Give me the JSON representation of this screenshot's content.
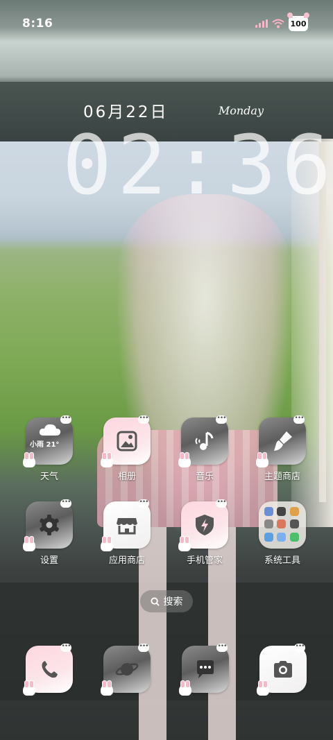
{
  "status_bar": {
    "time": "8:16",
    "battery_level": "100",
    "signal_icon": "signal-icon",
    "wifi_icon": "wifi-icon"
  },
  "clock_widget": {
    "date": "06月22日",
    "weekday": "Monday",
    "time": "02:36"
  },
  "weather_widget": {
    "text": "小雨 21°"
  },
  "apps": [
    {
      "name": "weather",
      "label": "天气",
      "icon": "cloud-icon",
      "tile_color": "#6e6e6e"
    },
    {
      "name": "gallery",
      "label": "相册",
      "icon": "photo-icon",
      "tile_color": "#ffd6df"
    },
    {
      "name": "music",
      "label": "音乐",
      "icon": "music-note-icon",
      "tile_color": "#6e6e6e"
    },
    {
      "name": "themes",
      "label": "主题商店",
      "icon": "paintbrush-icon",
      "tile_color": "#6e6e6e"
    },
    {
      "name": "settings",
      "label": "设置",
      "icon": "gear-icon",
      "tile_color": "#6e6e6e"
    },
    {
      "name": "app-store",
      "label": "应用商店",
      "icon": "store-icon",
      "tile_color": "#ffffff"
    },
    {
      "name": "phone-manager",
      "label": "手机管家",
      "icon": "shield-icon",
      "tile_color": "#ffd6df"
    },
    {
      "name": "system-tools",
      "label": "系统工具",
      "icon": "folder-icon",
      "tile_color": "#ffffff"
    }
  ],
  "search": {
    "label": "搜索",
    "icon": "search-icon"
  },
  "dock": [
    {
      "name": "phone",
      "icon": "phone-icon"
    },
    {
      "name": "browser",
      "icon": "planet-icon"
    },
    {
      "name": "messages",
      "icon": "chat-bubble-icon"
    },
    {
      "name": "camera",
      "icon": "camera-icon"
    }
  ],
  "colors": {
    "accent_pink": "#f7c0cf",
    "tile_gray": "#6e6e6e",
    "text": "#ffffff"
  }
}
